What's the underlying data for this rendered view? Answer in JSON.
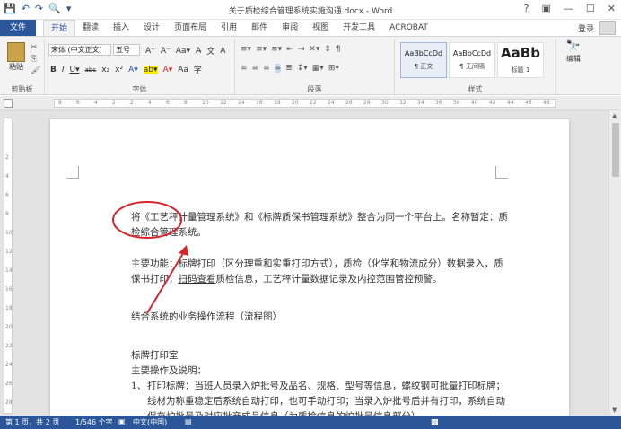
{
  "window": {
    "title": "关于质检综合管理系统实施沟通.docx - Word",
    "controls": [
      "?",
      "▣",
      "—",
      "☐",
      "✕"
    ]
  },
  "quick_access": [
    "save-icon",
    "undo-icon",
    "redo-icon",
    "print-preview-icon",
    "customize-icon"
  ],
  "tabs": {
    "file": "文件",
    "items": [
      "开始",
      "翻读",
      "插入",
      "设计",
      "页面布局",
      "引用",
      "邮件",
      "审阅",
      "视图",
      "开发工具",
      "ACROBAT"
    ],
    "active": "开始",
    "login": "登录"
  },
  "ribbon": {
    "clipboard": {
      "paste": "粘贴",
      "label": "剪贴板"
    },
    "font": {
      "name": "宋体 (中文正文)",
      "size": "五号",
      "row1": [
        "A⁺",
        "A⁻",
        "Aa▾",
        "A̶",
        "文",
        "A"
      ],
      "row2": [
        "B",
        "I",
        "U▾",
        "abc",
        "x₂",
        "x²",
        "A▾",
        "ab▾",
        "A▾",
        "Aa",
        "字"
      ],
      "label": "字体"
    },
    "paragraph": {
      "row1": [
        "≡▾",
        "≡▾",
        "≡▾",
        "⇤",
        "⇥",
        "✕▾",
        "↕",
        "¶"
      ],
      "row2": [
        "≡",
        "≡",
        "≡",
        "≡",
        "≣",
        "↕▾",
        "▦▾",
        "⊞▾"
      ],
      "label": "段落"
    },
    "styles": {
      "items": [
        {
          "sample": "AaBbCcDd",
          "name": "¶ 正文",
          "selected": true
        },
        {
          "sample": "AaBbCcDd",
          "name": "¶ 无间隔",
          "selected": false
        },
        {
          "sample": "AaBb",
          "name": "标题 1",
          "selected": false
        }
      ],
      "label": "样式"
    },
    "editing": {
      "label": "编辑"
    }
  },
  "ruler": {
    "h_ticks": [
      "8",
      "6",
      "4",
      "2",
      "2",
      "4",
      "6",
      "8",
      "10",
      "12",
      "14",
      "16",
      "18",
      "20",
      "22",
      "24",
      "26",
      "28",
      "30",
      "32",
      "34",
      "36",
      "38",
      "40",
      "42",
      "44",
      "46",
      "48"
    ],
    "v_ticks": [
      "2",
      "4",
      "6",
      "8",
      "10",
      "12",
      "14",
      "16",
      "18",
      "20",
      "22",
      "24",
      "26",
      "28"
    ]
  },
  "document": {
    "para1_line1": "将《工艺秤计量管理系统》和《标牌质保书管理系统》整合为同一个平台上。名称暂定：质",
    "para1_line2": "检综合管理系统。",
    "para2_line1": "主要功能：标牌打印（区分理重和实重打印方式），质检（化学和物流成分）数据录入，质",
    "para2_line2_a": "保书打印，",
    "para2_line2_b": "扫码查看",
    "para2_line2_c": "质检信息，工艺秤计量数据记录及内控范围管控预警。",
    "para3": "结合系统的业务操作流程（流程图）",
    "para4": "标牌打印室",
    "para5": "主要操作及说明：",
    "list1_num": "1、",
    "list1_line1": "打印标牌：当班人员录入炉批号及品名、规格、型号等信息，螺纹钢可批量打印标牌；",
    "list1_line2": "线材为称重稳定后系统自动打印，也可手动打印；当录入炉批号后并有打印，系统自动",
    "list1_line3": "保存炉批号及对应批产成品信息（为质检信息的炉批号信息部分）。"
  },
  "annotation": {
    "color": "#d9232a"
  },
  "statusbar": {
    "page": "第 1 页，共 2 页",
    "words": "1/546 个字",
    "lang": "中文(中国)"
  },
  "colors": {
    "accent": "#2b579a",
    "annotation": "#d9232a"
  }
}
